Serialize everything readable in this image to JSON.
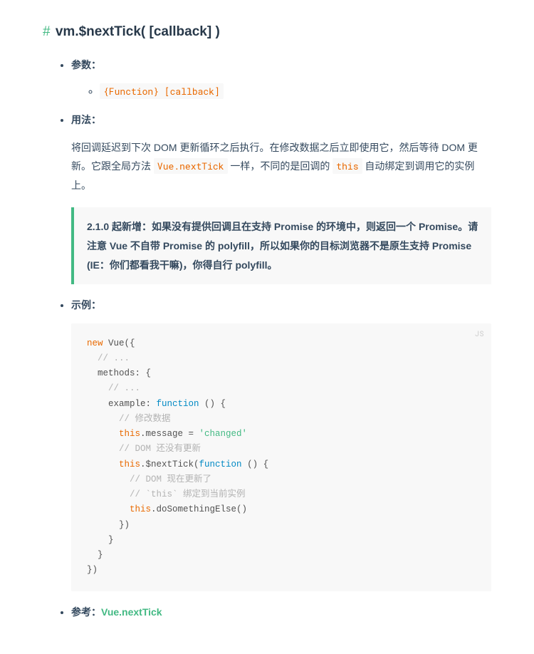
{
  "heading": {
    "hash": "#",
    "title": "vm.$nextTick( [callback] )"
  },
  "sections": {
    "params": {
      "label": "参数：",
      "item": "{Function} [callback]"
    },
    "usage": {
      "label": "用法：",
      "desc_pre1": "将回调延迟到下次 DOM 更新循环之后执行。在修改数据之后立即使用它，然后等待 DOM 更新。它跟全局方法 ",
      "desc_code1": "Vue.nextTick",
      "desc_mid": " 一样，不同的是回调的 ",
      "desc_code2": "this",
      "desc_post": " 自动绑定到调用它的实例上。",
      "tip": "2.1.0 起新增：如果没有提供回调且在支持 Promise 的环境中，则返回一个 Promise。请注意 Vue 不自带 Promise 的 polyfill，所以如果你的目标浏览器不是原生支持 Promise (IE：你们都看我干嘛)，你得自行 polyfill。"
    },
    "example": {
      "label": "示例：",
      "lang": "JS",
      "code": {
        "l1a": "new",
        "l1b": " Vue({",
        "l2": "// ...",
        "l3": "methods: {",
        "l4": "// ...",
        "l5a": "example: ",
        "l5b": "function",
        "l5c": " () {",
        "l6": "// 修改数据",
        "l7a": "this",
        "l7b": ".message = ",
        "l7c": "'changed'",
        "l8": "// DOM 还没有更新",
        "l9a": "this",
        "l9b": ".$nextTick(",
        "l9c": "function",
        "l9d": " () {",
        "l10": "// DOM 现在更新了",
        "l11": "// `this` 绑定到当前实例",
        "l12a": "this",
        "l12b": ".doSomethingElse()",
        "l13": "})",
        "l14": "}",
        "l15": "}",
        "l16": "})"
      }
    },
    "ref": {
      "label": "参考：",
      "link": "Vue.nextTick"
    }
  }
}
